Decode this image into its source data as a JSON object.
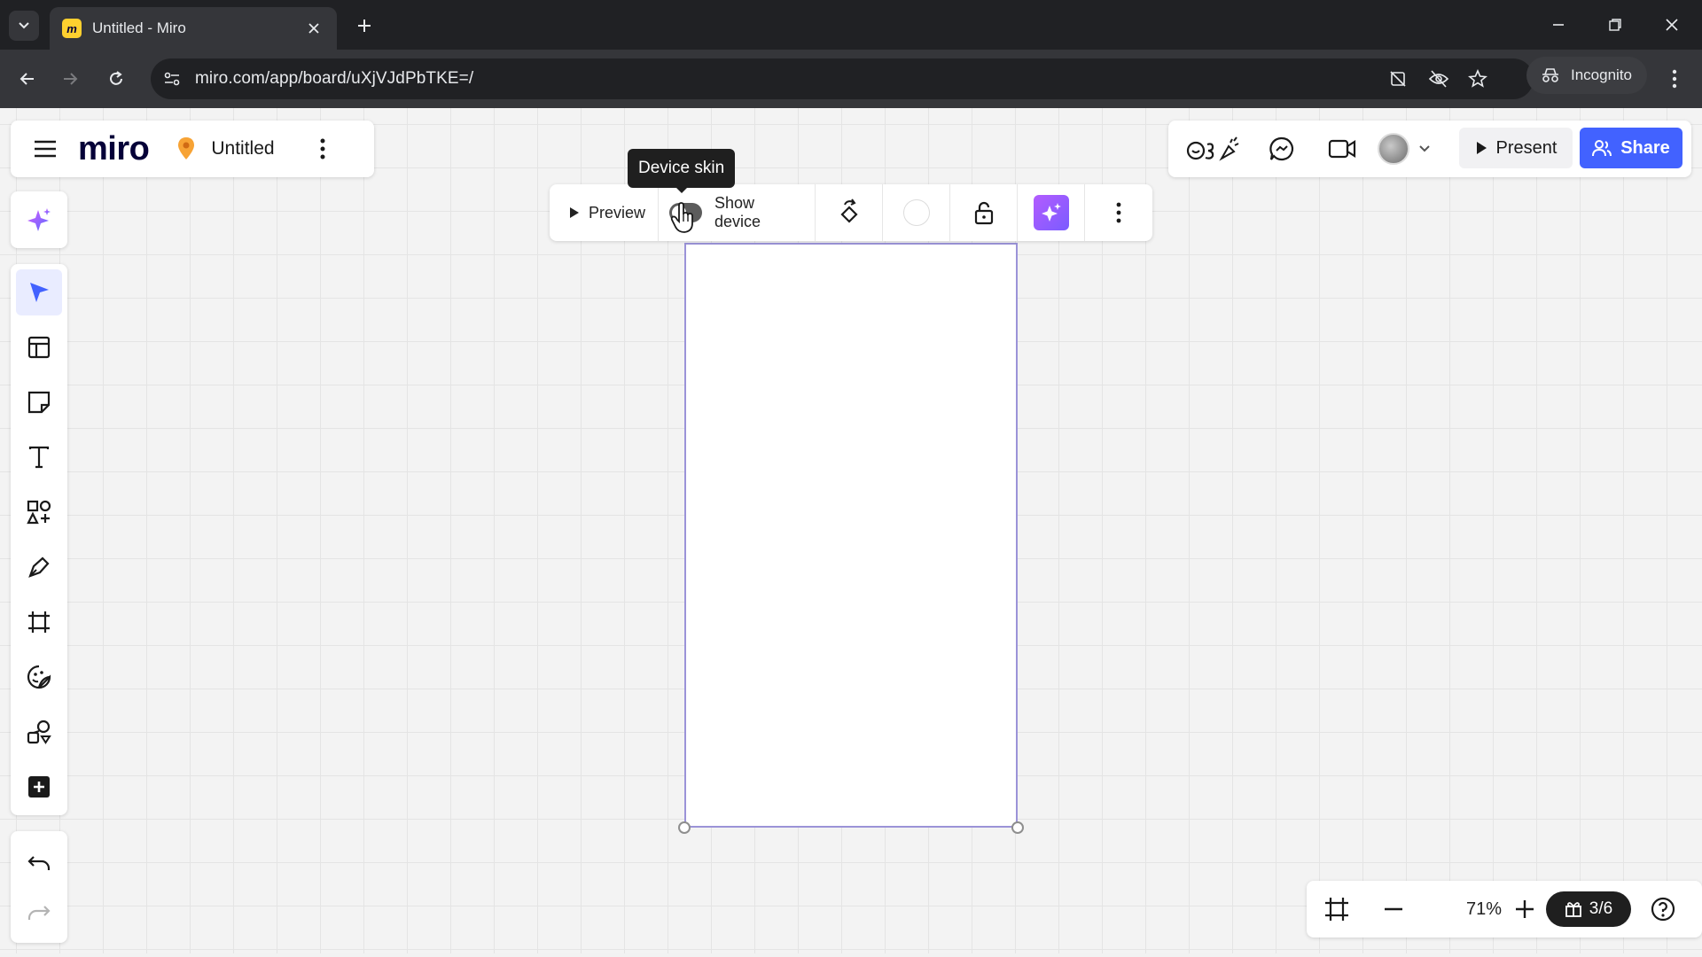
{
  "browser": {
    "tab_title": "Untitled - Miro",
    "url": "miro.com/app/board/uXjVJdPbTKE=/",
    "incognito_label": "Incognito"
  },
  "board": {
    "logo": "miro",
    "title": "Untitled"
  },
  "header": {
    "present_label": "Present",
    "share_label": "Share",
    "accent_color": "#4262ff"
  },
  "frame_toolbar": {
    "preview_label": "Preview",
    "show_device_label": "Show device",
    "tooltip": "Device skin",
    "show_device_on": true
  },
  "left_toolbar": {
    "tools": [
      "ai-sparkle-icon",
      "select-cursor-icon",
      "templates-icon",
      "sticky-note-icon",
      "text-icon",
      "shapes-icon",
      "pen-icon",
      "frame-icon",
      "sticker-icon",
      "diagram-icon",
      "add-icon"
    ],
    "active_tool": "select-cursor-icon"
  },
  "zoom": {
    "level": "71%",
    "gift_count": "3/6"
  }
}
